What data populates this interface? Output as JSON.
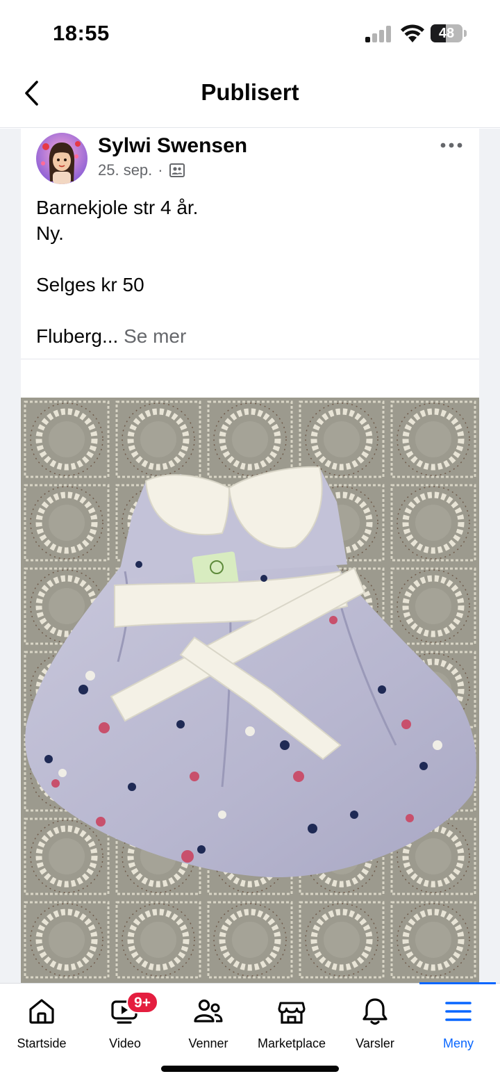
{
  "status_bar": {
    "time": "18:55",
    "battery_level": "48",
    "battery_fraction": 0.48,
    "icons": [
      "signal-icon",
      "wifi-icon",
      "battery-icon"
    ]
  },
  "header": {
    "title": "Publisert",
    "back_icon": "chevron-left-icon"
  },
  "post": {
    "author": "Sylwi Swensen",
    "date": "25. sep.",
    "separator": "·",
    "audience_icon": "group-audience-icon",
    "more_icon": "more-horizontal-icon",
    "text_lines": [
      "Barnekjole str 4 år.",
      "Ny.",
      "",
      "Selges kr 50",
      ""
    ],
    "truncated_line": "Fluberg...",
    "see_more": "Se mer",
    "photo": "photo of a lavender floral child's dress with white collar and sash"
  },
  "bottom_nav": {
    "items": [
      {
        "label": "Startside",
        "icon": "home-icon"
      },
      {
        "label": "Video",
        "icon": "video-icon",
        "badge": "9+"
      },
      {
        "label": "Venner",
        "icon": "friends-icon"
      },
      {
        "label": "Marketplace",
        "icon": "marketplace-icon"
      },
      {
        "label": "Varsler",
        "icon": "bell-icon"
      },
      {
        "label": "Meny",
        "icon": "menu-icon",
        "active": true
      }
    ]
  },
  "colors": {
    "accent": "#0866ff",
    "badge": "#e41e3f",
    "secondary_text": "#65676b"
  }
}
